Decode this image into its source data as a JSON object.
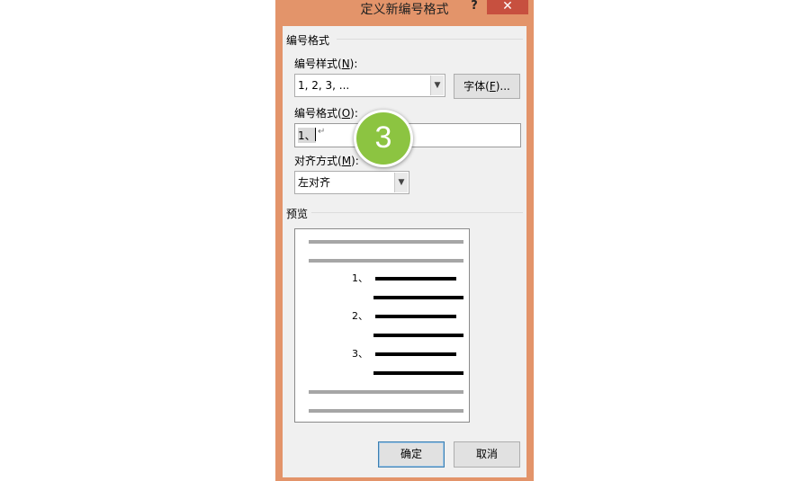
{
  "dialog": {
    "title": "定义新编号格式",
    "help_label": "?",
    "close_label": "✕"
  },
  "group_numbering": {
    "label": "编号格式"
  },
  "style": {
    "label_text": "编号样式(",
    "label_key": "N",
    "label_end": "):",
    "value": "1, 2, 3, ..."
  },
  "font_button": {
    "text": "字体(",
    "key": "F",
    "end": ")..."
  },
  "format": {
    "label_text": "编号格式(",
    "label_key": "O",
    "label_end": "):",
    "value": "1、",
    "paragraph_mark": "↵"
  },
  "alignment": {
    "label_text": "对齐方式(",
    "label_key": "M",
    "label_end": "):",
    "value": "左对齐"
  },
  "preview": {
    "label": "预览",
    "numbers": [
      "1、",
      "2、",
      "3、"
    ]
  },
  "step_badge": {
    "text": "3",
    "color": "#8cc441"
  },
  "buttons": {
    "ok": "确定",
    "cancel": "取消"
  }
}
